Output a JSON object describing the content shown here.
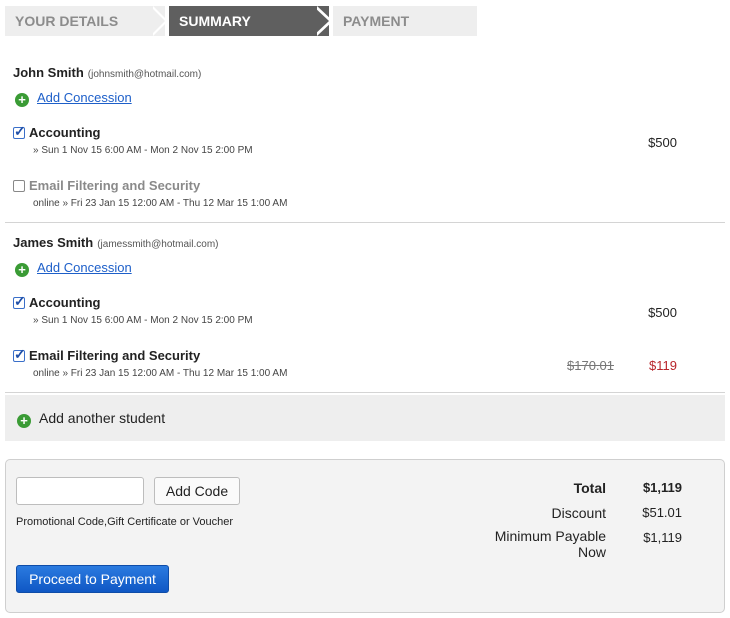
{
  "steps": [
    "YOUR DETAILS",
    "SUMMARY",
    "PAYMENT"
  ],
  "students": [
    {
      "name": "John Smith",
      "email": "(johnsmith@hotmail.com)",
      "concession_label": "Add Concession",
      "courses": [
        {
          "title": "Accounting",
          "checked": true,
          "dates": "» Sun 1 Nov 15 6:00 AM ‑ Mon 2 Nov 15 2:00 PM",
          "price": "$500"
        },
        {
          "title": "Email Filtering and Security",
          "checked": false,
          "dates": "online » Fri 23 Jan 15 12:00 AM ‑ Thu 12 Mar 15 1:00 AM"
        }
      ]
    },
    {
      "name": "James Smith",
      "email": "(jamessmith@hotmail.com)",
      "concession_label": "Add Concession",
      "courses": [
        {
          "title": "Accounting",
          "checked": true,
          "dates": "» Sun 1 Nov 15 6:00 AM ‑ Mon 2 Nov 15 2:00 PM",
          "price": "$500"
        },
        {
          "title": "Email Filtering and Security",
          "checked": true,
          "dates": "online » Fri 23 Jan 15 12:00 AM ‑ Thu 12 Mar 15 1:00 AM",
          "original_price": "$170.01",
          "price": "$119"
        }
      ]
    }
  ],
  "add_student_label": "Add another student",
  "promo": {
    "input_value": "",
    "add_code_label": "Add Code",
    "hint": "Promotional Code,Gift Certificate or Voucher"
  },
  "proceed_label": "Proceed to Payment",
  "totals": {
    "total_label": "Total",
    "total_value": "$1,119",
    "discount_label": "Discount",
    "discount_value": "$51.01",
    "min_label_1": "Minimum Payable",
    "min_label_2": "Now",
    "min_value": "$1,119"
  },
  "colors": {
    "accent": "#1d5fc9",
    "active_step": "#5f5f5f",
    "discount_price": "#b8252a",
    "plus_icon": "#3a9b35"
  },
  "icons": [
    "add-circle-icon",
    "checkbox-checked-icon",
    "checkbox-empty-icon"
  ]
}
